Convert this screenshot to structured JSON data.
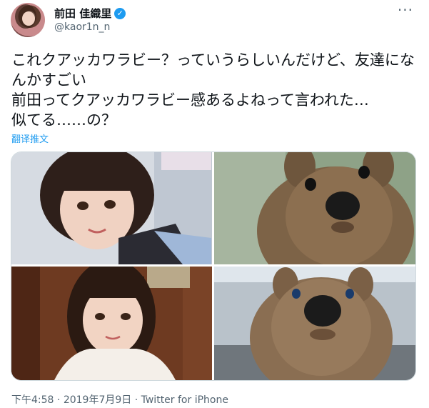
{
  "author": {
    "name": "前田 佳織里",
    "handle": "@kaor1n_n",
    "verified_icon": "✓"
  },
  "more_icon": "···",
  "tweet": {
    "text": "これクアッカワラビー？っていうらしいんだけど、友達になんかすごい\n前田ってクアッカワラビー感あるよねって言われた…\n似てる……の？",
    "translate_label": "翻译推文"
  },
  "meta": {
    "time": "下午4:58",
    "sep1": " · ",
    "date": "2019年7月9日",
    "sep2": " · ",
    "app": "Twitter for iPhone"
  },
  "colors": {
    "link": "#1d9bf0",
    "secondary_text": "#536471",
    "verified": "#1d9bf0"
  }
}
